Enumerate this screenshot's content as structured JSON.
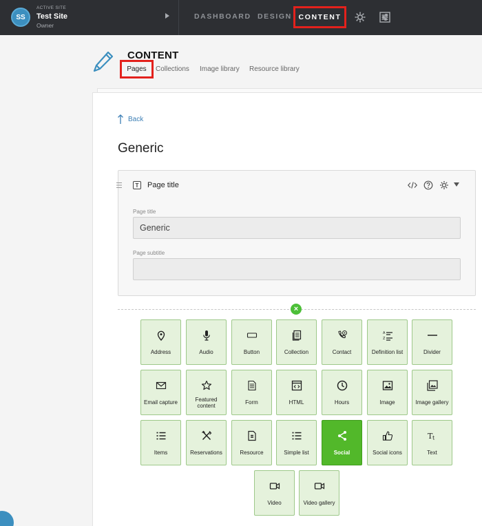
{
  "topbar": {
    "site_label": "ACTIVE SITE",
    "site_name": "Test Site",
    "site_role": "Owner",
    "avatar_initials": "SS",
    "nav": {
      "dashboard": "DASHBOARD",
      "design": "DESIGN",
      "content": "CONTENT"
    }
  },
  "section": {
    "title": "CONTENT",
    "tabs": {
      "pages": "Pages",
      "collections": "Collections",
      "image_library": "Image library",
      "resource_library": "Resource library"
    }
  },
  "main": {
    "back_label": "Back",
    "page_heading": "Generic",
    "block": {
      "title": "Page title",
      "fields": {
        "page_title_label": "Page title",
        "page_title_value": "Generic",
        "page_subtitle_label": "Page subtitle",
        "page_subtitle_value": ""
      }
    }
  },
  "tiles": [
    {
      "label": "Address",
      "icon": "map-pin-icon"
    },
    {
      "label": "Audio",
      "icon": "microphone-icon"
    },
    {
      "label": "Button",
      "icon": "button-icon"
    },
    {
      "label": "Collection",
      "icon": "collection-icon"
    },
    {
      "label": "Contact",
      "icon": "phone-contact-icon"
    },
    {
      "label": "Definition list",
      "icon": "definition-list-icon"
    },
    {
      "label": "Divider",
      "icon": "divider-icon"
    },
    {
      "label": "Email capture",
      "icon": "envelope-icon"
    },
    {
      "label": "Featured content",
      "icon": "star-icon"
    },
    {
      "label": "Form",
      "icon": "form-icon"
    },
    {
      "label": "HTML",
      "icon": "html-icon"
    },
    {
      "label": "Hours",
      "icon": "clock-icon"
    },
    {
      "label": "Image",
      "icon": "image-icon"
    },
    {
      "label": "Image gallery",
      "icon": "image-gallery-icon"
    },
    {
      "label": "Items",
      "icon": "items-list-icon"
    },
    {
      "label": "Reservations",
      "icon": "utensils-icon"
    },
    {
      "label": "Resource",
      "icon": "resource-icon"
    },
    {
      "label": "Simple list",
      "icon": "simple-list-icon"
    },
    {
      "label": "Social",
      "icon": "share-icon"
    },
    {
      "label": "Social icons",
      "icon": "thumbs-up-icon"
    },
    {
      "label": "Text",
      "icon": "text-icon"
    },
    {
      "label": "Video",
      "icon": "video-icon"
    },
    {
      "label": "Video gallery",
      "icon": "video-gallery-icon"
    }
  ],
  "colors": {
    "topbar_bg": "#2d2f33",
    "highlight_red": "#e3211c",
    "tile_bg": "#e5f2dc",
    "tile_active": "#52b82a",
    "link_blue": "#3d7fb5"
  }
}
